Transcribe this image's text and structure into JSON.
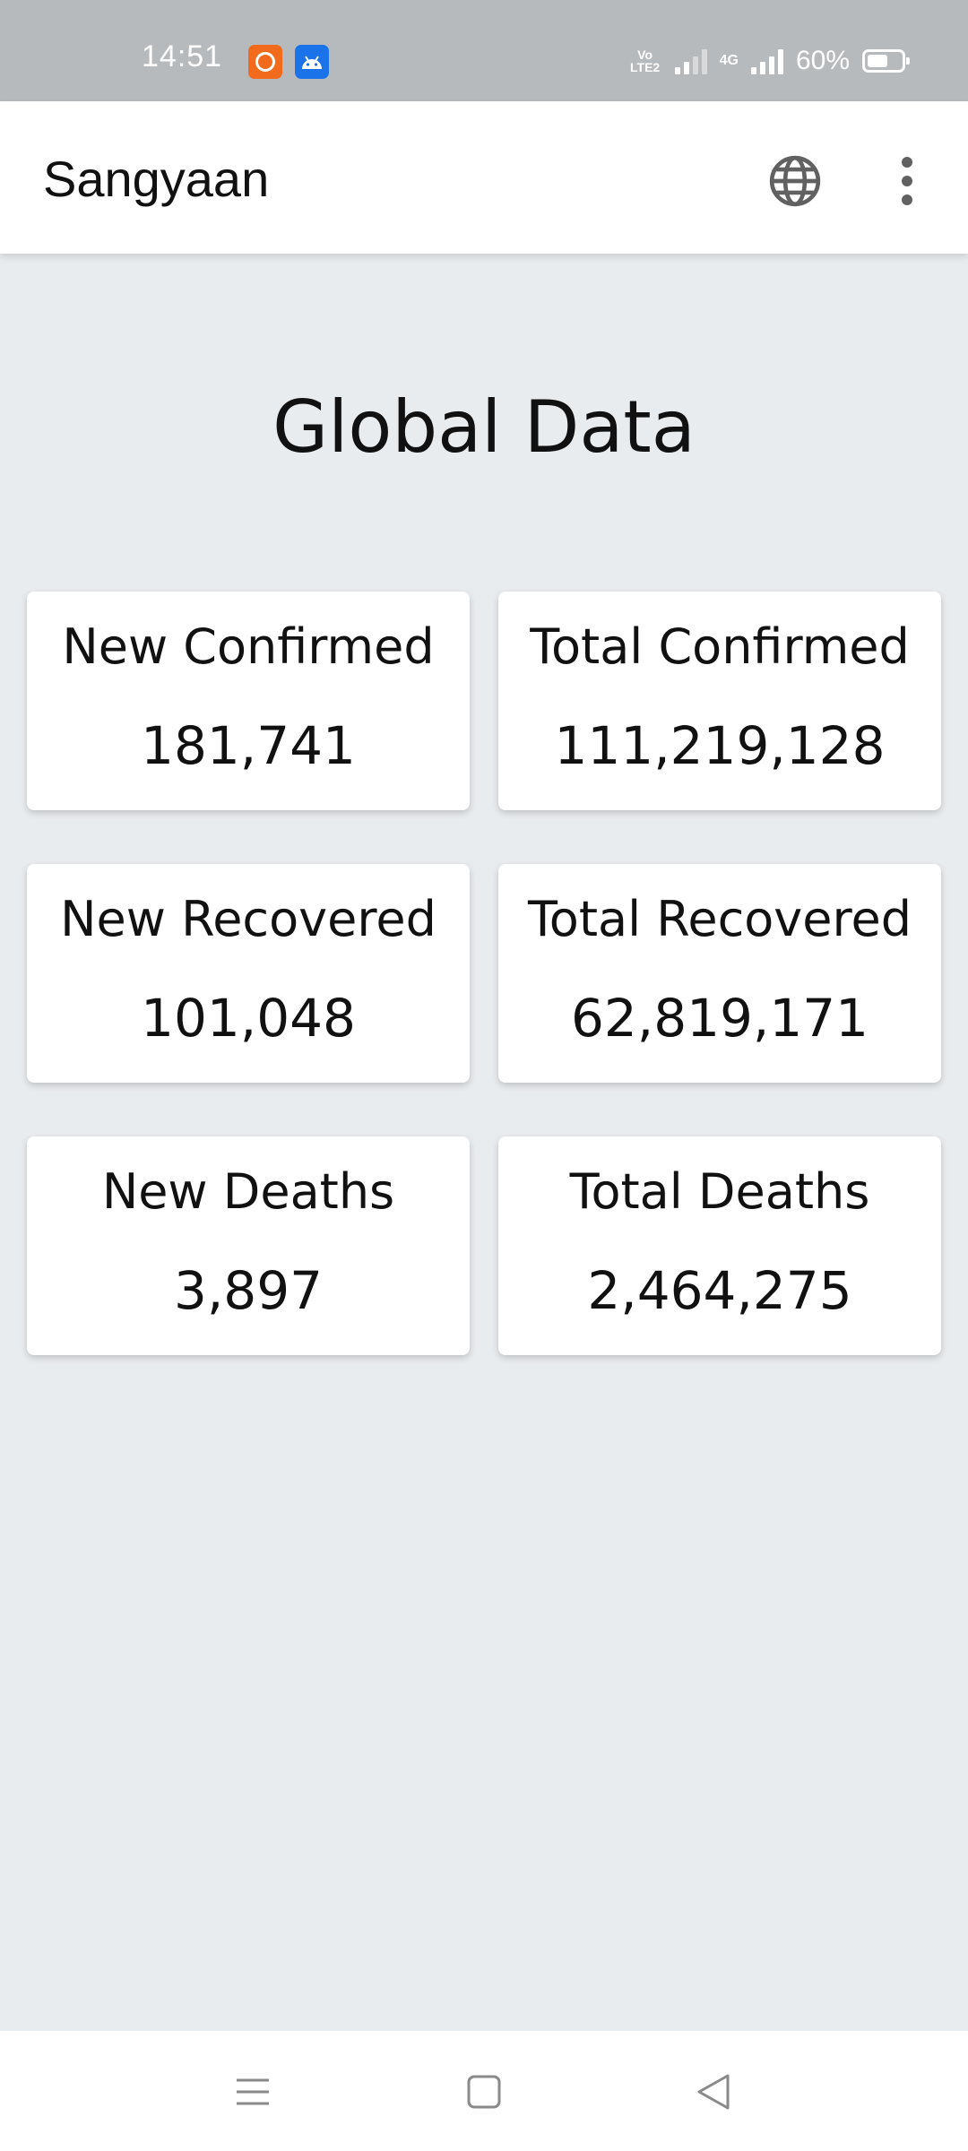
{
  "status_bar": {
    "time": "14:51",
    "notification_icons": [
      "mi-app-icon",
      "android-icon"
    ],
    "volte_label": "Vo LTE2",
    "network_type": "4G",
    "battery_percent": "60%",
    "battery_level": 0.6
  },
  "app_bar": {
    "title": "Sangyaan",
    "actions": [
      "globe-icon",
      "more-vert-icon"
    ]
  },
  "main": {
    "heading": "Global Data",
    "stats": [
      {
        "label": "New Confirmed",
        "value": "181,741"
      },
      {
        "label": "Total Confirmed",
        "value": "111,219,128"
      },
      {
        "label": "New Recovered",
        "value": "101,048"
      },
      {
        "label": "Total Recovered",
        "value": "62,819,171"
      },
      {
        "label": "New Deaths",
        "value": "3,897"
      },
      {
        "label": "Total Deaths",
        "value": "2,464,275"
      }
    ]
  },
  "nav_bar": {
    "buttons": [
      "menu-icon",
      "home-square-icon",
      "back-triangle-icon"
    ]
  },
  "colors": {
    "status_bar_bg": "#b7babd",
    "app_bar_bg": "#ffffff",
    "page_bg": "#e9ecef",
    "card_bg": "#ffffff",
    "icon_gray": "#616161",
    "mi_orange": "#f26a1b",
    "android_blue": "#1a73e8"
  }
}
